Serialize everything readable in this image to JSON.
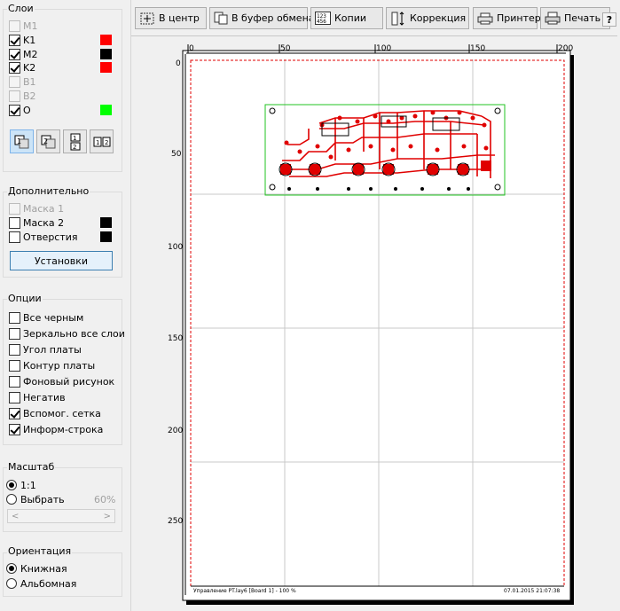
{
  "layers": {
    "title": "Слои",
    "items": [
      {
        "label": "M1",
        "checked": false,
        "disabled": true,
        "color": ""
      },
      {
        "label": "K1",
        "checked": true,
        "disabled": false,
        "color": "#ff0000"
      },
      {
        "label": "M2",
        "checked": true,
        "disabled": false,
        "color": "#000000"
      },
      {
        "label": "K2",
        "checked": true,
        "disabled": false,
        "color": "#ff0000"
      },
      {
        "label": "B1",
        "checked": false,
        "disabled": true,
        "color": ""
      },
      {
        "label": "B2",
        "checked": false,
        "disabled": true,
        "color": ""
      },
      {
        "label": "O",
        "checked": true,
        "disabled": false,
        "color": "#00ff00"
      }
    ]
  },
  "additional": {
    "title": "Дополнительно",
    "items": [
      {
        "label": "Маска 1",
        "checked": false,
        "disabled": true,
        "color": ""
      },
      {
        "label": "Маска 2",
        "checked": false,
        "disabled": false,
        "color": "#000000"
      },
      {
        "label": "Отверстия",
        "checked": false,
        "disabled": false,
        "color": "#000000"
      }
    ],
    "settings_button": "Установки"
  },
  "options": {
    "title": "Опции",
    "items": [
      {
        "label": "Все черным",
        "checked": false
      },
      {
        "label": "Зеркально все слои",
        "checked": false
      },
      {
        "label": "Угол платы",
        "checked": false
      },
      {
        "label": "Контур платы",
        "checked": false
      },
      {
        "label": "Фоновый рисунок",
        "checked": false
      },
      {
        "label": "Негатив",
        "checked": false
      },
      {
        "label": "Вспомог. сетка",
        "checked": true
      },
      {
        "label": "Информ-строка",
        "checked": true
      }
    ]
  },
  "scale": {
    "title": "Масштаб",
    "option_1to1": "1:1",
    "option_custom": "Выбрать",
    "custom_value": "60%",
    "selected": "1:1"
  },
  "orientation": {
    "title": "Ориентация",
    "portrait": "Книжная",
    "landscape": "Альбомная",
    "selected": "portrait"
  },
  "toolbar": {
    "center": "В центр",
    "clipboard": "В буфер обмена",
    "copies": "Копии",
    "correction": "Коррекция",
    "printer": "Принтер",
    "print": "Печать",
    "help": "?"
  },
  "ruler": {
    "top_labels": [
      "0",
      "50",
      "100",
      "150",
      "200"
    ],
    "left_labels": [
      "0",
      "50",
      "100",
      "150",
      "200",
      "250"
    ]
  },
  "info_line": {
    "left": "Управление PT.lay6 [Board 1] - 100 %",
    "right": "07.01.2015 21:07:38"
  }
}
